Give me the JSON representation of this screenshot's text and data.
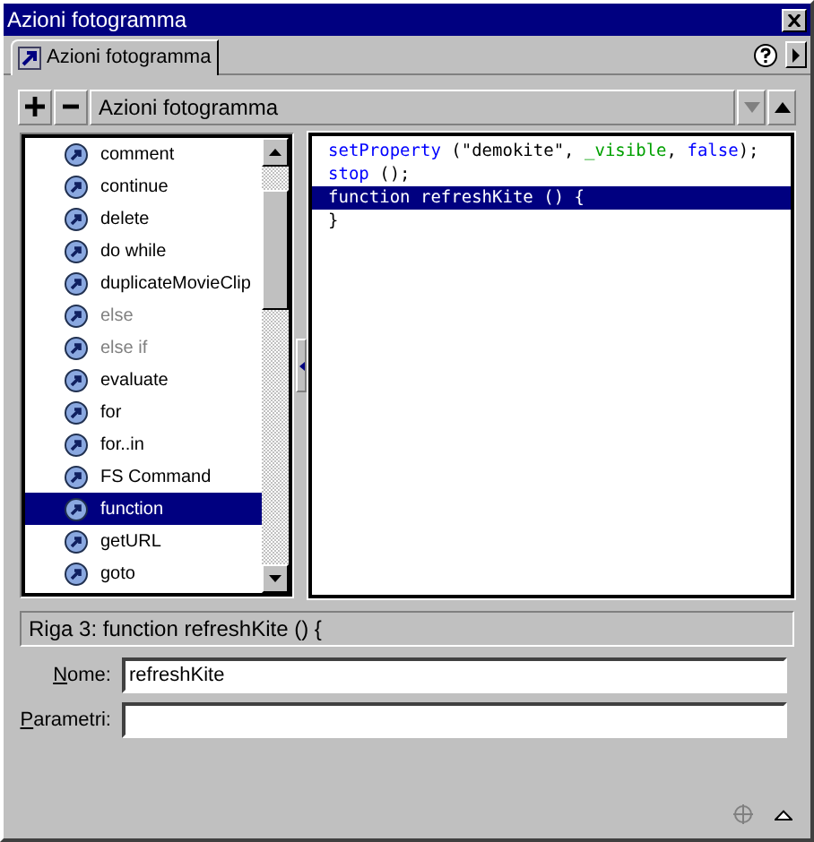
{
  "window": {
    "title": "Azioni fotogramma"
  },
  "tabs": [
    {
      "label": "Azioni fotogramma",
      "selected": true
    }
  ],
  "toolbar": {
    "title": "Azioni fotogramma"
  },
  "actions": [
    {
      "label": "comment",
      "selected": false,
      "disabled": false
    },
    {
      "label": "continue",
      "selected": false,
      "disabled": false
    },
    {
      "label": "delete",
      "selected": false,
      "disabled": false
    },
    {
      "label": "do while",
      "selected": false,
      "disabled": false
    },
    {
      "label": "duplicateMovieClip",
      "selected": false,
      "disabled": false
    },
    {
      "label": "else",
      "selected": false,
      "disabled": true
    },
    {
      "label": "else if",
      "selected": false,
      "disabled": true
    },
    {
      "label": "evaluate",
      "selected": false,
      "disabled": false
    },
    {
      "label": "for",
      "selected": false,
      "disabled": false
    },
    {
      "label": "for..in",
      "selected": false,
      "disabled": false
    },
    {
      "label": "FS Command",
      "selected": false,
      "disabled": false
    },
    {
      "label": "function",
      "selected": true,
      "disabled": false
    },
    {
      "label": "getURL",
      "selected": false,
      "disabled": false
    },
    {
      "label": "goto",
      "selected": false,
      "disabled": false
    }
  ],
  "code_lines": [
    {
      "selected": false,
      "tokens": [
        {
          "kind": "keyword",
          "text": "setProperty"
        },
        {
          "kind": "plain",
          "text": " (\"demokite\", "
        },
        {
          "kind": "property",
          "text": "_visible"
        },
        {
          "kind": "plain",
          "text": ", "
        },
        {
          "kind": "keyword",
          "text": "false"
        },
        {
          "kind": "plain",
          "text": ");"
        }
      ]
    },
    {
      "selected": false,
      "tokens": [
        {
          "kind": "keyword",
          "text": "stop"
        },
        {
          "kind": "plain",
          "text": " ();"
        }
      ]
    },
    {
      "selected": true,
      "tokens": [
        {
          "kind": "keyword",
          "text": "function"
        },
        {
          "kind": "plain",
          "text": " refreshKite () {"
        }
      ]
    },
    {
      "selected": false,
      "tokens": [
        {
          "kind": "plain",
          "text": "}"
        }
      ]
    }
  ],
  "status": "Riga 3: function refreshKite () {",
  "fields": [
    {
      "label": "Nome:",
      "value": "refreshKite"
    },
    {
      "label": "Parametri:"
    }
  ]
}
